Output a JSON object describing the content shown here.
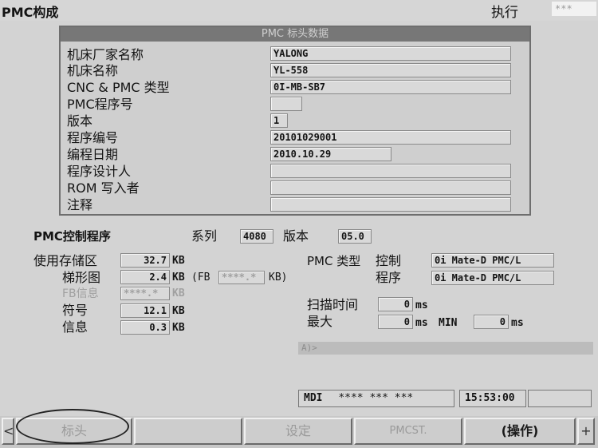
{
  "header": {
    "title": "PMC构成",
    "mode": "执行",
    "alarm": "***"
  },
  "title_data": {
    "heading": "PMC 标头数据",
    "rows": [
      {
        "label": "机床厂家名称",
        "value": "YALONG"
      },
      {
        "label": "机床名称",
        "value": "YL-558"
      },
      {
        "label": "CNC & PMC 类型",
        "value": "0I-MB-SB7"
      },
      {
        "label": "PMC程序号",
        "value": ""
      },
      {
        "label": "版本",
        "value": "1"
      },
      {
        "label": "程序编号",
        "value": "20101029001"
      },
      {
        "label": "编程日期",
        "value": "2010.10.29"
      },
      {
        "label": "程序设计人",
        "value": ""
      },
      {
        "label": "ROM 写入者",
        "value": ""
      },
      {
        "label": "注释",
        "value": ""
      }
    ]
  },
  "program": {
    "label": "PMC控制程序",
    "series_label": "系列",
    "series_value": "4080",
    "version_label": "版本",
    "version_value": "05.0"
  },
  "memory": {
    "used_label": "使用存储区",
    "used_value": "32.7",
    "ladder_label": "梯形图",
    "ladder_value": "2.4",
    "fb_label": "FB",
    "fb_value": "****.*",
    "fb_info_label": "FB信息",
    "fb_info_value": "****.*",
    "symbol_label": "符号",
    "symbol_value": "12.1",
    "message_label": "信息",
    "message_value": "0.3",
    "unit": "KB",
    "fb_open": "(FB",
    "fb_close": "KB)"
  },
  "pmc_type": {
    "label": "PMC 类型",
    "control_label": "控制",
    "control_value": "0i Mate-D PMC/L",
    "program_label": "程序",
    "program_value": "0i Mate-D PMC/L"
  },
  "scan": {
    "label": "扫描时间",
    "value": "0",
    "max_label": "最大",
    "max_value": "0",
    "min_label": "MIN",
    "min_value": "0",
    "unit": "ms"
  },
  "command_line": "A)>",
  "status": {
    "mode": "MDI",
    "text": "**** *** ***",
    "time": "15:53:00"
  },
  "softkeys": [
    "标头",
    "",
    "设定",
    "PMCST.",
    "(操作)"
  ],
  "softkey_left": "<",
  "softkey_right": "+"
}
